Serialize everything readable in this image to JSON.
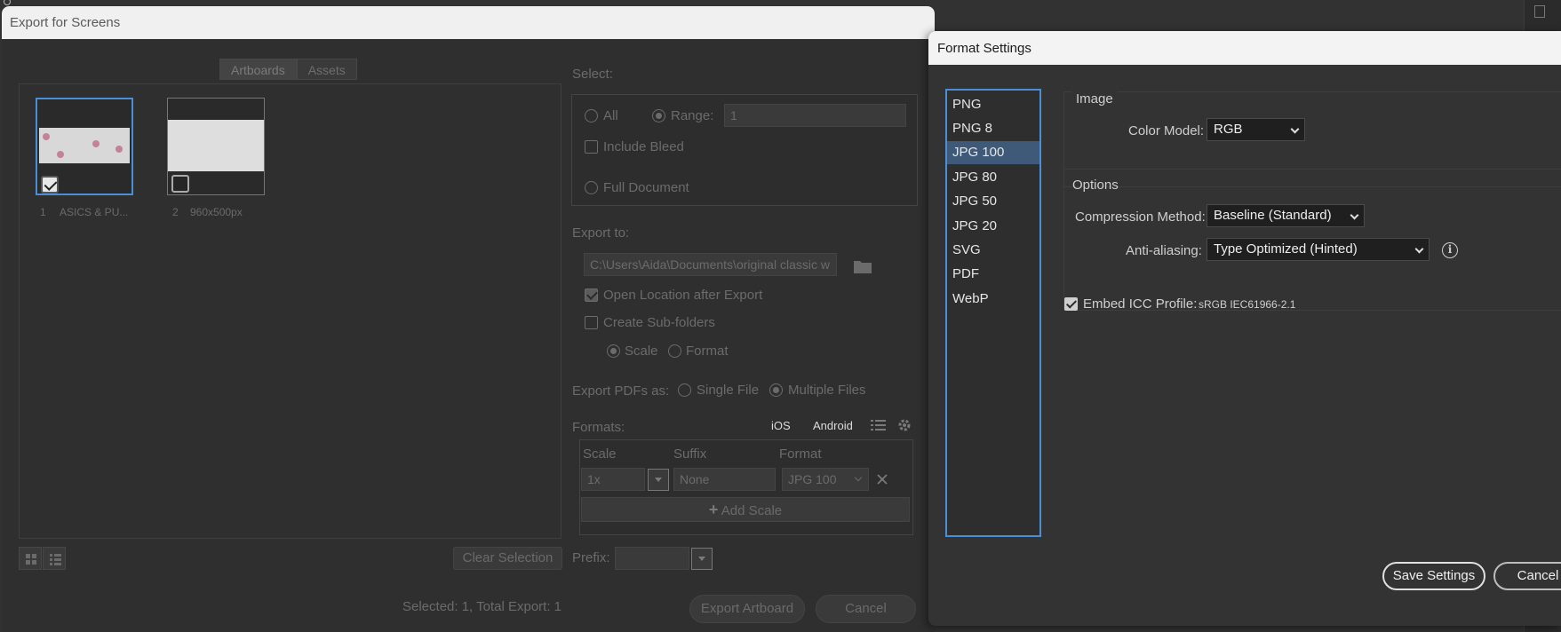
{
  "export_dialog": {
    "title": "Export for Screens",
    "tabs": [
      "Artboards",
      "Assets"
    ],
    "artboards": [
      {
        "number": "1",
        "name": "ASICS & PU...",
        "checked": true
      },
      {
        "number": "2",
        "name": "960x500px",
        "checked": false
      }
    ],
    "clear_selection": "Clear Selection",
    "select_label": "Select:",
    "all_label": "All",
    "range_label": "Range:",
    "range_value": "1",
    "include_bleed": "Include Bleed",
    "full_document": "Full Document",
    "export_to_label": "Export to:",
    "export_path": "C:\\Users\\Aida\\Documents\\original classic w",
    "open_location": "Open Location after Export",
    "create_subfolders": "Create Sub-folders",
    "scale_label": "Scale",
    "format_label": "Format",
    "export_pdfs_label": "Export PDFs as:",
    "single_file": "Single File",
    "multiple_files": "Multiple Files",
    "formats_label": "Formats:",
    "ios": "iOS",
    "android": "Android",
    "columns": [
      "Scale",
      "Suffix",
      "Format"
    ],
    "row": {
      "scale": "1x",
      "suffix_placeholder": "None",
      "format": "JPG 100"
    },
    "add_scale": "Add Scale",
    "prefix_label": "Prefix:",
    "status": "Selected: 1, Total Export: 1",
    "export_button": "Export Artboard",
    "cancel_button": "Cancel"
  },
  "format_settings": {
    "title": "Format Settings",
    "formats": [
      "PNG",
      "PNG 8",
      "JPG 100",
      "JPG 80",
      "JPG 50",
      "JPG 20",
      "SVG",
      "PDF",
      "WebP"
    ],
    "selected_format": "JPG 100",
    "image_heading": "Image",
    "color_model_label": "Color Model:",
    "color_model_value": "RGB",
    "options_heading": "Options",
    "compression_label": "Compression Method:",
    "compression_value": "Baseline (Standard)",
    "antialias_label": "Anti-aliasing:",
    "antialias_value": "Type Optimized (Hinted)",
    "info_glyph": "i",
    "embed_icc_label": "Embed ICC Profile:",
    "icc_profile_value": "sRGB IEC61966-2.1",
    "save_button": "Save Settings",
    "cancel_button": "Cancel"
  },
  "colors": {
    "accent": "#4a8fd6",
    "selected_item": "#3f5a78"
  }
}
